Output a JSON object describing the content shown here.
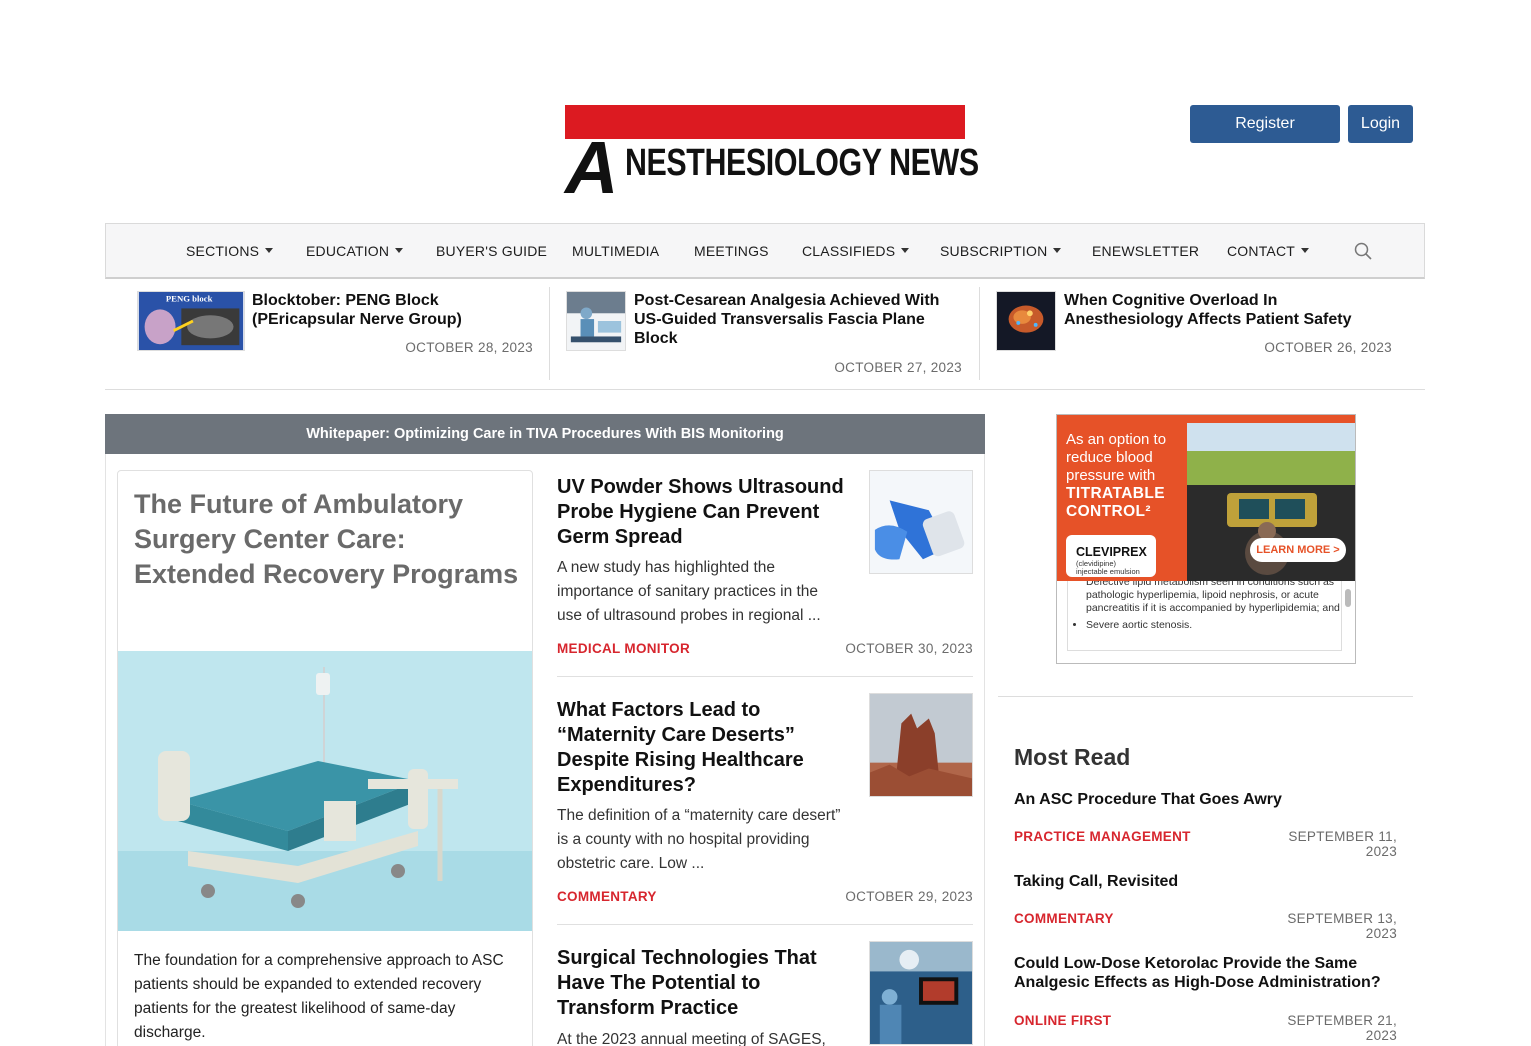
{
  "header": {
    "logo_text": "NESTHESIOLOGY NEWS",
    "logo_letter": "A",
    "register_label": "Register",
    "login_label": "Login",
    "brand_red": "#dc1a21",
    "button_blue": "#2d5b93"
  },
  "nav": {
    "items": [
      {
        "label": "SECTIONS",
        "dropdown": true
      },
      {
        "label": "EDUCATION",
        "dropdown": true
      },
      {
        "label": "BUYER'S GUIDE",
        "dropdown": false
      },
      {
        "label": "MULTIMEDIA",
        "dropdown": false
      },
      {
        "label": "MEETINGS",
        "dropdown": false
      },
      {
        "label": "CLASSIFIEDS",
        "dropdown": true
      },
      {
        "label": "SUBSCRIPTION",
        "dropdown": true
      },
      {
        "label": "ENEWSLETTER",
        "dropdown": false
      },
      {
        "label": "CONTACT",
        "dropdown": true
      }
    ],
    "search_icon": "search-icon"
  },
  "top_stories": [
    {
      "title": "Blocktober: PENG Block (PEricapsular Nerve Group)",
      "date": "OCTOBER 28, 2023",
      "thumb_label": "PENG block"
    },
    {
      "title": "Post-Cesarean Analgesia Achieved With US-Guided Transversalis Fascia Plane Block",
      "date": "OCTOBER 27, 2023"
    },
    {
      "title": "When Cognitive Overload In Anesthesiology Affects Patient Safety",
      "date": "OCTOBER 26, 2023"
    }
  ],
  "whitepaper": {
    "label": "Whitepaper: Optimizing Care in TIVA Procedures With BIS Monitoring"
  },
  "feature": {
    "title": "The Future of Ambulatory Surgery Center Care: Extended Recovery Programs",
    "text": "The foundation for a comprehensive approach to ASC patients should be expanded to extended recovery patients for the greatest likelihood of same-day discharge."
  },
  "articles": [
    {
      "title": "UV Powder Shows Ultrasound Probe Hygiene Can Prevent Germ Spread",
      "excerpt": "A new study has highlighted the importance of sanitary practices in the use of ultrasound probes in regional ...",
      "category": "MEDICAL MONITOR",
      "date": "OCTOBER 30, 2023"
    },
    {
      "title": "What Factors Lead to “Maternity Care Deserts” Despite Rising Healthcare Expenditures?",
      "excerpt": "The definition of a “maternity care desert” is a county with no hospital providing obstetric care. Low ...",
      "category": "COMMENTARY",
      "date": "OCTOBER 29, 2023"
    },
    {
      "title": "Surgical Technologies That Have The Potential to Transform Practice",
      "excerpt": "At the 2023 annual meeting of SAGES,"
    }
  ],
  "ad": {
    "line1": "As an option to reduce blood pressure with",
    "line2": "TITRATABLE CONTROL²",
    "brand": "CLEVIPREX",
    "brand_sub": "(clevidipine) injectable emulsion",
    "cta": "LEARN MORE >",
    "isi_cont": "Defective lipid metabolism seen in conditions such as pathologic hyperlipemia, lipoid nephrosis, or acute pancreatitis if it is accompanied by hyperlipidemia; and",
    "isi_item": "Severe aortic stenosis.",
    "accent": "#e65228"
  },
  "most_read": {
    "title": "Most Read",
    "items": [
      {
        "title": "An ASC Procedure That Goes Awry",
        "category": "PRACTICE MANAGEMENT",
        "date": "SEPTEMBER 11, 2023"
      },
      {
        "title": "Taking Call, Revisited",
        "category": "COMMENTARY",
        "date": "SEPTEMBER 13, 2023"
      },
      {
        "title": "Could Low-Dose Ketorolac Provide the Same Analgesic Effects as High-Dose Administration?",
        "category": "ONLINE FIRST",
        "date": "SEPTEMBER 21, 2023"
      }
    ]
  }
}
